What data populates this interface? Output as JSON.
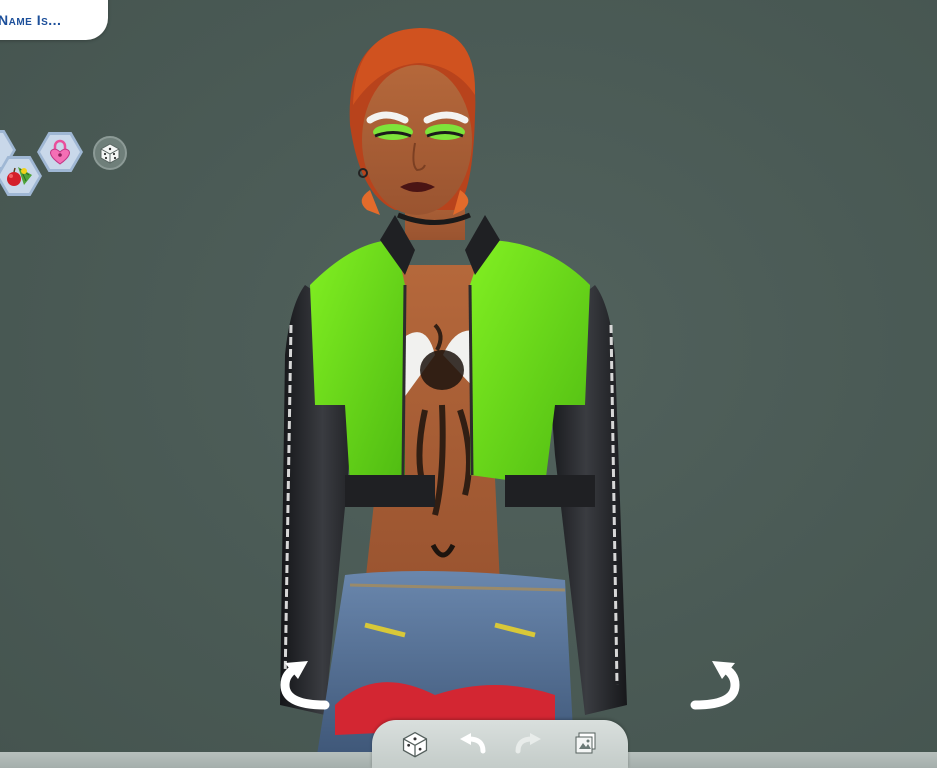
{
  "header": {
    "name_label": "Name Is..."
  },
  "traits": [
    {
      "icon": "partial-trait-icon"
    },
    {
      "icon": "lock-heart-icon"
    },
    {
      "icon": "fruit-veggie-icon"
    }
  ],
  "controls": {
    "randomize_icon": "dice-icon",
    "rotate_left_icon": "rotate-left-arrow-icon",
    "rotate_right_icon": "rotate-right-arrow-icon"
  },
  "toolbar": {
    "buttons": [
      "dice-icon",
      "undo-icon",
      "redo-icon",
      "gallery-icon"
    ]
  },
  "colors": {
    "background": "#4a5a55",
    "banner_text": "#1c4f9a",
    "jacket_green": "#6fe21c",
    "jacket_black": "#1e1f22",
    "hair": "#c2471f"
  }
}
